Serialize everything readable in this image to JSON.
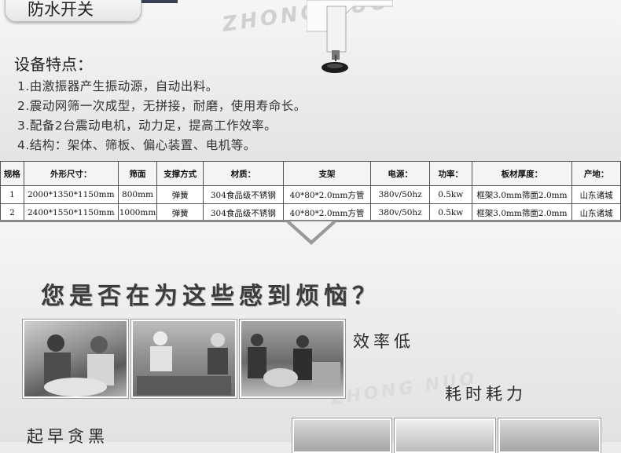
{
  "badge": {
    "title": "防水开关"
  },
  "watermarks": {
    "top": "ZHONG NUO",
    "bottom": "ZHONG NUO"
  },
  "features": {
    "heading": "设备特点：",
    "items": [
      "1.由激振器产生振动源，自动出料。",
      "2.震动网筛一次成型，无拼接，耐磨，使用寿命长。",
      "3.配备2台震动电机，动力足，提高工作效率。",
      "4.结构：架体、筛板、偏心装置、电机等。"
    ]
  },
  "spec_table": {
    "headers": [
      "规格",
      "外形尺寸：",
      "筛面",
      "支撑方式",
      "材质：",
      "支架",
      "电源：",
      "功率：",
      "板材厚度：",
      "产地："
    ],
    "rows": [
      [
        "1",
        "2000*1350*1150mm",
        "800mm",
        "弹簧",
        "304食品级不锈钢",
        "40*80*2.0mm方管",
        "380v/50hz",
        "0.5kw",
        "框架3.0mm筛面2.0mm",
        "山东诸城"
      ],
      [
        "2",
        "2400*1550*1150mm",
        "1000mm",
        "弹簧",
        "304食品级不锈钢",
        "40*80*2.0mm方管",
        "380v/50hz",
        "0.5kw",
        "框架3.0mm筛面2.0mm",
        "山东诸城"
      ]
    ]
  },
  "problems": {
    "question": "您是否在为这些感到烦恼？",
    "captions": {
      "efficiency": "效率低",
      "labor": "耗时耗力",
      "early": "起早贪黑"
    }
  },
  "icons": {
    "machine": "machine-leg-icon",
    "arrow": "down-arrow-icon"
  }
}
